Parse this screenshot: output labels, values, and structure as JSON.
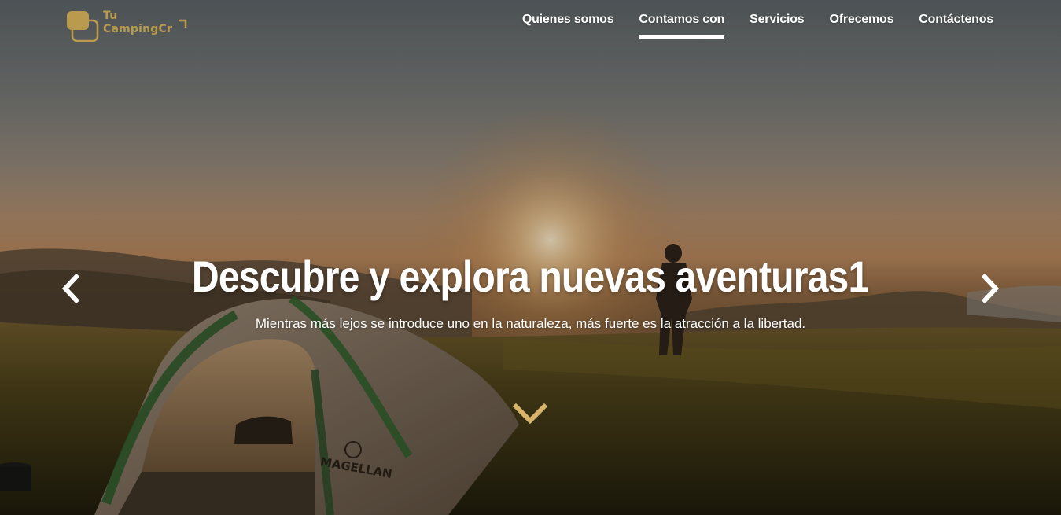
{
  "brand": {
    "line1": "Tu",
    "line2": "CampingCr",
    "color": "#b99a4f"
  },
  "nav": {
    "items": [
      {
        "label": "Quienes somos",
        "active": false
      },
      {
        "label": "Contamos con",
        "active": true
      },
      {
        "label": "Servicios",
        "active": false
      },
      {
        "label": "Ofrecemos",
        "active": false
      },
      {
        "label": "Contáctenos",
        "active": false
      }
    ]
  },
  "carousel": {
    "title": "Descubre y explora nuevas aventuras1",
    "subtitle": "Mientras más lejos se introduce uno en la naturaleza, más fuerte es la atracción a la libertad.",
    "prev_icon": "chevron-left-icon",
    "next_icon": "chevron-right-icon"
  },
  "scroll": {
    "icon": "chevron-down-icon",
    "color": "#d8b46a"
  },
  "tent": {
    "brand_text": "MAGELLAN"
  }
}
